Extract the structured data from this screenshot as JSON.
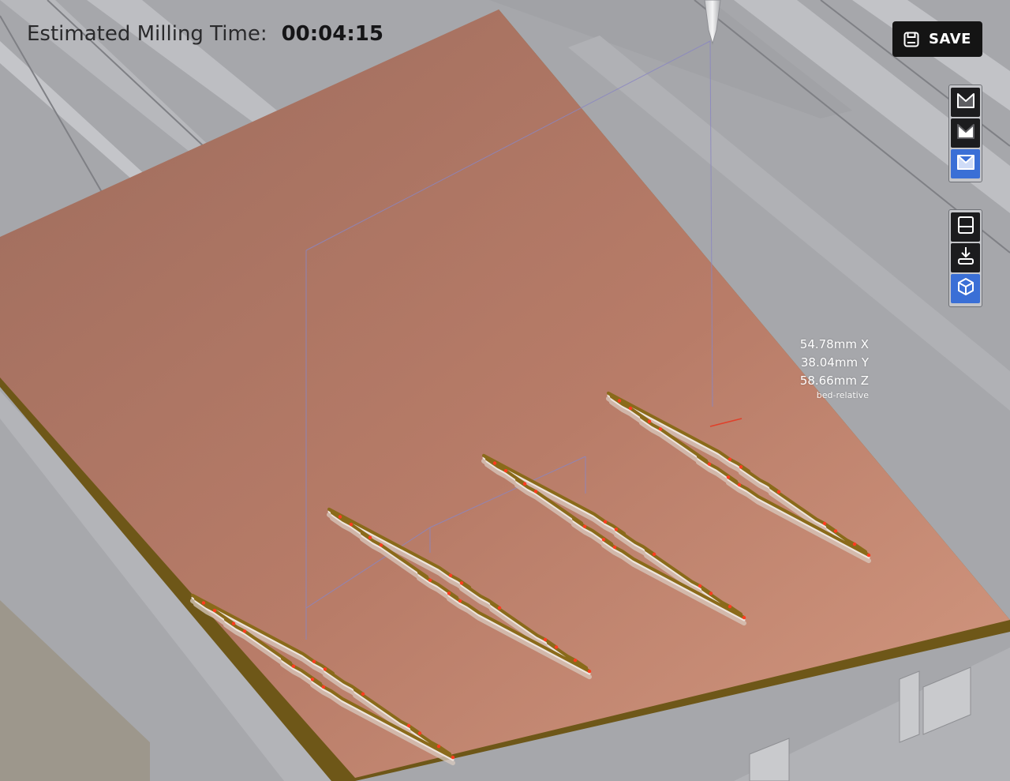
{
  "header": {
    "estimate_label": "Estimated Milling Time:",
    "estimate_value": "00:04:15"
  },
  "toolbar": {
    "save_label": "SAVE",
    "save_icon": "save-icon",
    "view_groups": [
      [
        {
          "icon": "material-cut-dark-icon",
          "active": false
        },
        {
          "icon": "material-cut-light-icon",
          "active": false
        },
        {
          "icon": "material-cut-outline-icon",
          "active": true
        }
      ],
      [
        {
          "icon": "view-top-icon",
          "active": false
        },
        {
          "icon": "view-front-icon",
          "active": false
        },
        {
          "icon": "view-3d-cube-icon",
          "active": true
        }
      ]
    ]
  },
  "position_readout": {
    "x": "54.78mm X",
    "y": "38.04mm Y",
    "z": "58.66mm Z",
    "reference": "bed-relative"
  },
  "colors": {
    "background": "#a6a7ab",
    "copper_board": "#b37a66",
    "board_edge": "#6e5718",
    "toolpath": "#8a6a1a",
    "accent_active": "#3a6fd6",
    "button_dark": "#141414"
  }
}
